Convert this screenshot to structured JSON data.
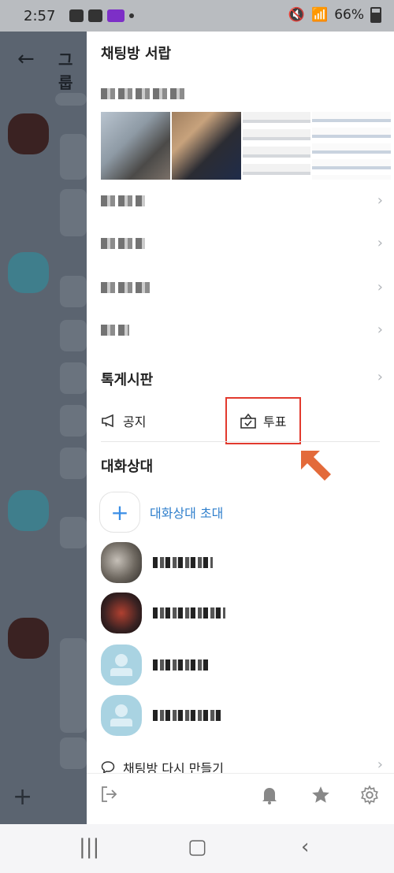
{
  "status_bar": {
    "time": "2:57",
    "battery": "66%"
  },
  "chat": {
    "title": "그룹"
  },
  "drawer": {
    "title": "채팅방 서랍",
    "board_title": "톡게시판",
    "notice_label": "공지",
    "vote_label": "투표",
    "members_title": "대화상대",
    "invite_label": "대화상대 초대",
    "recreate_label": "채팅방 다시 만들기"
  },
  "colors": {
    "highlight": "#e23a2e",
    "accent_blue": "#2f7fcc",
    "arrow": "#e36a3a"
  }
}
